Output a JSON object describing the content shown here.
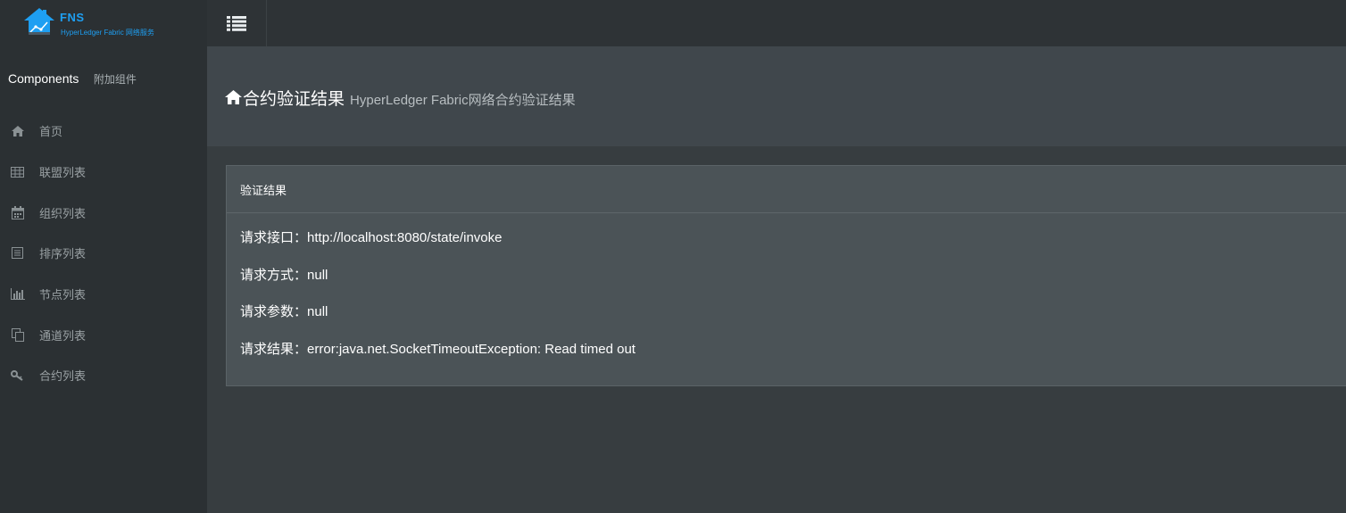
{
  "brand": {
    "title": "FNS",
    "subtitle": "HyperLedger Fabric 网络服务",
    "color": "#1e9ff2"
  },
  "sidebar": {
    "section_title": "Components",
    "section_subtitle": "附加组件",
    "items": [
      {
        "label": "首页",
        "icon": "home-icon"
      },
      {
        "label": "联盟列表",
        "icon": "table-icon"
      },
      {
        "label": "组织列表",
        "icon": "calendar-icon"
      },
      {
        "label": "排序列表",
        "icon": "list-alt-icon"
      },
      {
        "label": "节点列表",
        "icon": "bar-chart-icon"
      },
      {
        "label": "通道列表",
        "icon": "copy-icon"
      },
      {
        "label": "合约列表",
        "icon": "key-icon"
      }
    ]
  },
  "topbar": {
    "toggle_icon": "menu-list-icon"
  },
  "page": {
    "title": "合约验证结果",
    "subtitle": "HyperLedger Fabric网络合约验证结果"
  },
  "panel": {
    "heading": "验证结果",
    "rows": [
      {
        "label": "请求接口：",
        "value": "http://localhost:8080/state/invoke"
      },
      {
        "label": "请求方式：",
        "value": "null"
      },
      {
        "label": "请求参数：",
        "value": "null"
      },
      {
        "label": "请求结果：",
        "value": "error:java.net.SocketTimeoutException: Read timed out"
      }
    ]
  }
}
